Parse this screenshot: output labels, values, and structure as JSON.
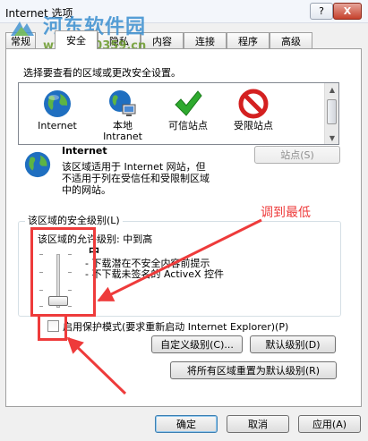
{
  "window": {
    "title": "Internet 选项",
    "help_label": "?",
    "close_label": "X"
  },
  "watermark": {
    "title": "河东软件园",
    "url": "www.pc0359.cn"
  },
  "tabs": [
    {
      "label": "常规"
    },
    {
      "label": "安全"
    },
    {
      "label": "隐私"
    },
    {
      "label": "内容"
    },
    {
      "label": "连接"
    },
    {
      "label": "程序"
    },
    {
      "label": "高级"
    }
  ],
  "security": {
    "select_zone_prompt": "选择要查看的区域或更改安全设置。",
    "zones": [
      {
        "label": "Internet",
        "icon": "globe-icon"
      },
      {
        "label": "本地",
        "label2": "Intranet",
        "icon": "intranet-icon"
      },
      {
        "label": "可信站点",
        "icon": "checkmark-icon"
      },
      {
        "label": "受限站点",
        "icon": "no-entry-icon"
      }
    ],
    "zone_title": "Internet",
    "zone_description": [
      "该区域适用于 Internet 网站，但",
      "不适用于列在受信任和受限制区域",
      "中的网站。"
    ],
    "sites_button": "站点(S)",
    "level_group_label": "该区域的安全级别(L)",
    "allowed_level_label": "该区域的允许级别: 中到高",
    "current_level": "中",
    "level_bullets": [
      "- 下载潜在不安全内容前提示",
      "- 不下载未签名的 ActiveX 控件"
    ],
    "protected_mode_label": "启用保护模式(要求重新启动 Internet Explorer)(P)",
    "protected_mode_checked": false,
    "custom_level_button": "自定义级别(C)...",
    "default_level_button": "默认级别(D)",
    "reset_all_button": "将所有区域重置为默认级别(R)"
  },
  "annotation": {
    "text": "调到最低",
    "color": "#ee3b3b"
  },
  "footer": {
    "ok_button": "确定",
    "cancel_button": "取消",
    "apply_button": "应用(A)"
  }
}
